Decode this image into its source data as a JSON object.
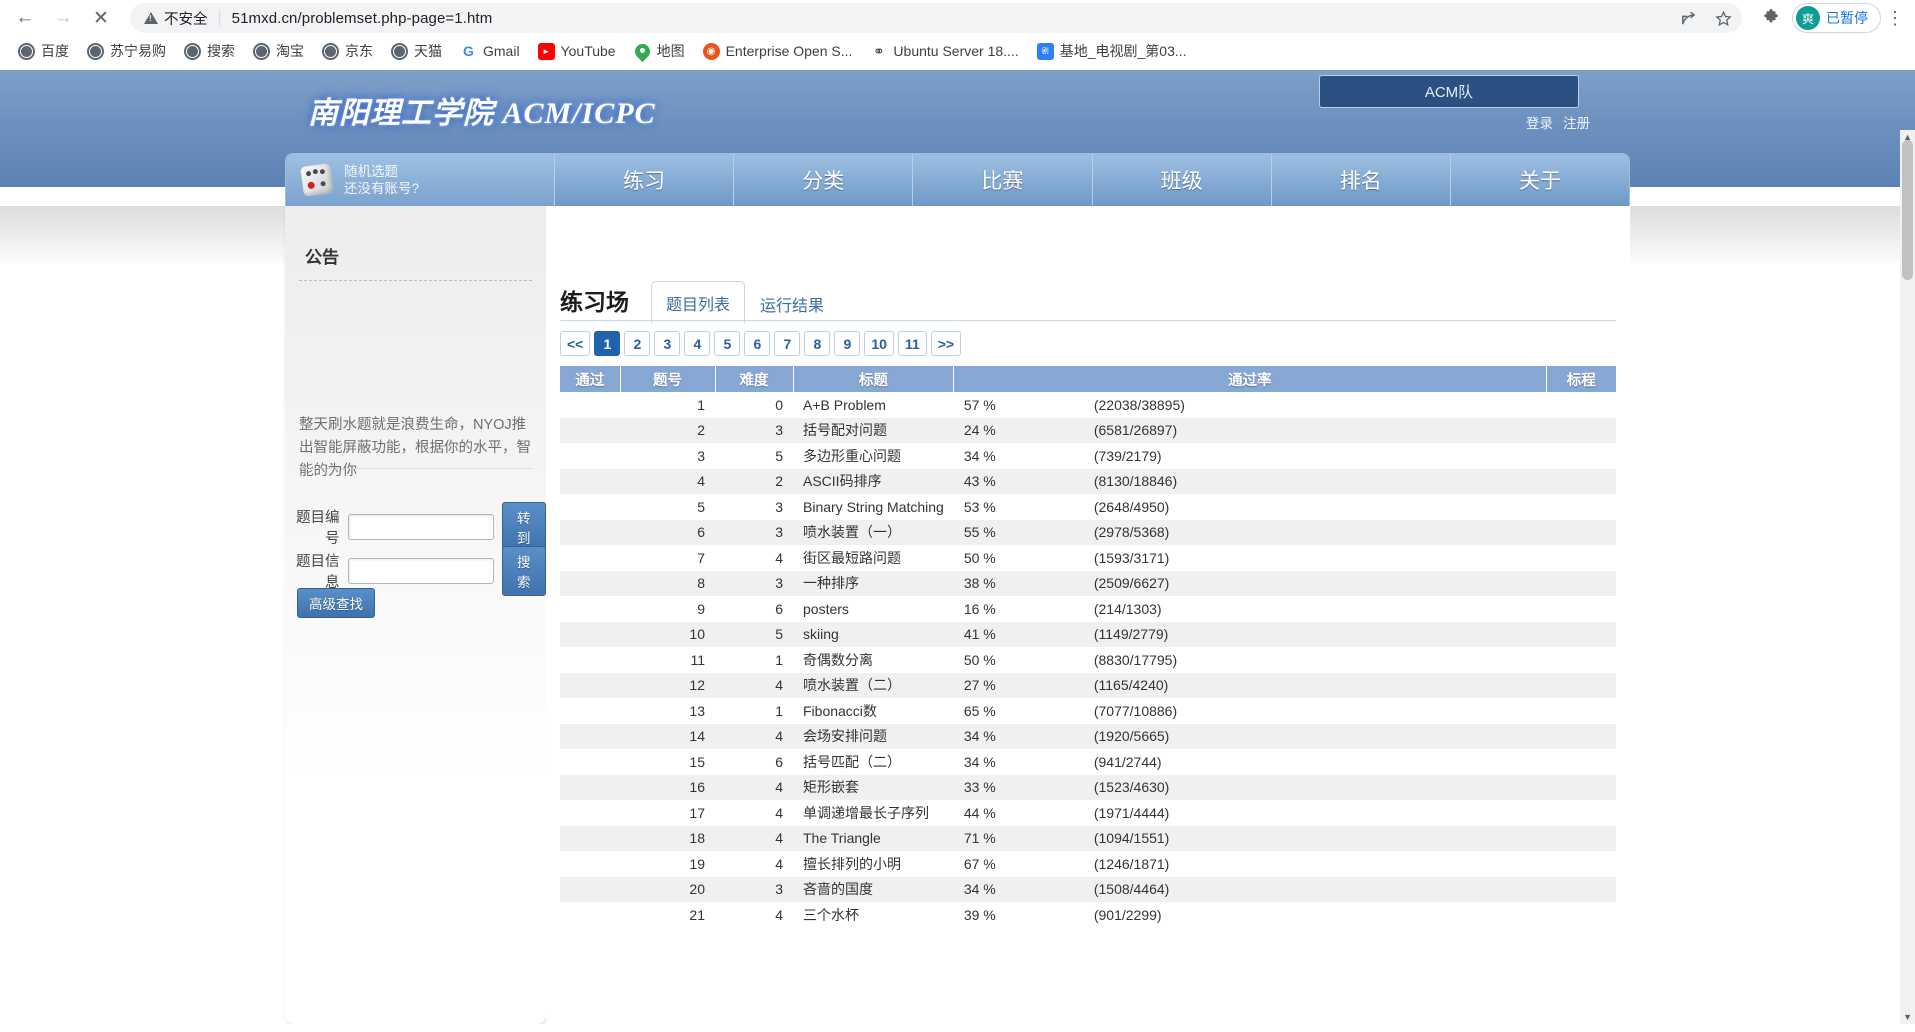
{
  "browser": {
    "back_icon": "back-arrow-icon",
    "forward_icon": "forward-arrow-icon",
    "stop_icon": "stop-icon",
    "stop_glyph": "✕",
    "security_label": "不安全",
    "url": "51mxd.cn/problemset.php-page=1.htm",
    "share_glyph": "↪",
    "star_glyph": "☆",
    "extensions_glyph": "✦",
    "profile_initial": "爽",
    "profile_status": "已暂停",
    "menu_glyph": "⋮",
    "bookmarks": [
      {
        "label": "百度",
        "icon": "globe-icon",
        "kind": "globe"
      },
      {
        "label": "苏宁易购",
        "icon": "globe-icon",
        "kind": "globe"
      },
      {
        "label": "搜索",
        "icon": "globe-icon",
        "kind": "globe"
      },
      {
        "label": "淘宝",
        "icon": "globe-icon",
        "kind": "globe"
      },
      {
        "label": "京东",
        "icon": "globe-icon",
        "kind": "globe"
      },
      {
        "label": "天猫",
        "icon": "globe-icon",
        "kind": "globe"
      },
      {
        "label": "Gmail",
        "icon": "gmail-icon",
        "kind": "g"
      },
      {
        "label": "YouTube",
        "icon": "youtube-icon",
        "kind": "yt"
      },
      {
        "label": "地图",
        "icon": "map-pin-icon",
        "kind": "map"
      },
      {
        "label": "Enterprise Open S...",
        "icon": "ubuntu-icon",
        "kind": "ubuntu"
      },
      {
        "label": "Ubuntu Server 18....",
        "icon": "ubuntu-logo-icon",
        "kind": "ubu2"
      },
      {
        "label": "基地_电视剧_第03...",
        "icon": "video-site-icon",
        "kind": "blue"
      }
    ]
  },
  "site": {
    "logo_text": "南阳理工学院 ACM/ICPC",
    "team_box": "ACM队",
    "login": "登录",
    "register": "注册",
    "nav": {
      "random_title": "随机选题",
      "random_sub": "还没有账号?",
      "items": [
        "练习",
        "分类",
        "比赛",
        "班级",
        "排名",
        "关于"
      ]
    }
  },
  "sidebar": {
    "notice_title": "公告",
    "notice_text": "整天刷水题就是浪费生命，NYOJ推出智能屏蔽功能，根据你的水平，智能的为你",
    "problem_id_label": "题目编号",
    "problem_id_value": "",
    "problem_id_placeholder": "",
    "goto_button": "转到",
    "problem_info_label": "题目信息",
    "problem_info_value": "",
    "problem_info_placeholder": "",
    "search_button": "搜索",
    "advanced_button": "高级查找"
  },
  "main": {
    "page_title": "练习场",
    "tabs": [
      {
        "label": "题目列表",
        "active": true
      },
      {
        "label": "运行结果",
        "active": false
      }
    ],
    "pager": [
      {
        "label": "<<",
        "active": false
      },
      {
        "label": "1",
        "active": true
      },
      {
        "label": "2",
        "active": false
      },
      {
        "label": "3",
        "active": false
      },
      {
        "label": "4",
        "active": false
      },
      {
        "label": "5",
        "active": false
      },
      {
        "label": "6",
        "active": false
      },
      {
        "label": "7",
        "active": false
      },
      {
        "label": "8",
        "active": false
      },
      {
        "label": "9",
        "active": false
      },
      {
        "label": "10",
        "active": false
      },
      {
        "label": "11",
        "active": false
      },
      {
        "label": ">>",
        "active": false
      }
    ],
    "table": {
      "headers": [
        "通过",
        "题号",
        "难度",
        "标题",
        "通过率",
        "标程"
      ],
      "rows": [
        {
          "pass": "",
          "id": "1",
          "difficulty": "0",
          "title": "A+B Problem",
          "rate": "57 %",
          "submissions": "(22038/38895)",
          "std": ""
        },
        {
          "pass": "",
          "id": "2",
          "difficulty": "3",
          "title": "括号配对问题",
          "rate": "24 %",
          "submissions": "(6581/26897)",
          "std": ""
        },
        {
          "pass": "",
          "id": "3",
          "difficulty": "5",
          "title": "多边形重心问题",
          "rate": "34 %",
          "submissions": "(739/2179)",
          "std": ""
        },
        {
          "pass": "",
          "id": "4",
          "difficulty": "2",
          "title": "ASCII码排序",
          "rate": "43 %",
          "submissions": "(8130/18846)",
          "std": ""
        },
        {
          "pass": "",
          "id": "5",
          "difficulty": "3",
          "title": "Binary String Matching",
          "rate": "53 %",
          "submissions": "(2648/4950)",
          "std": ""
        },
        {
          "pass": "",
          "id": "6",
          "difficulty": "3",
          "title": "喷水装置（一）",
          "rate": "55 %",
          "submissions": "(2978/5368)",
          "std": ""
        },
        {
          "pass": "",
          "id": "7",
          "difficulty": "4",
          "title": "街区最短路问题",
          "rate": "50 %",
          "submissions": "(1593/3171)",
          "std": ""
        },
        {
          "pass": "",
          "id": "8",
          "difficulty": "3",
          "title": "一种排序",
          "rate": "38 %",
          "submissions": "(2509/6627)",
          "std": ""
        },
        {
          "pass": "",
          "id": "9",
          "difficulty": "6",
          "title": "posters",
          "rate": "16 %",
          "submissions": "(214/1303)",
          "std": ""
        },
        {
          "pass": "",
          "id": "10",
          "difficulty": "5",
          "title": "skiing",
          "rate": "41 %",
          "submissions": "(1149/2779)",
          "std": ""
        },
        {
          "pass": "",
          "id": "11",
          "difficulty": "1",
          "title": "奇偶数分离",
          "rate": "50 %",
          "submissions": "(8830/17795)",
          "std": ""
        },
        {
          "pass": "",
          "id": "12",
          "difficulty": "4",
          "title": "喷水装置（二）",
          "rate": "27 %",
          "submissions": "(1165/4240)",
          "std": ""
        },
        {
          "pass": "",
          "id": "13",
          "difficulty": "1",
          "title": "Fibonacci数",
          "rate": "65 %",
          "submissions": "(7077/10886)",
          "std": ""
        },
        {
          "pass": "",
          "id": "14",
          "difficulty": "4",
          "title": "会场安排问题",
          "rate": "34 %",
          "submissions": "(1920/5665)",
          "std": ""
        },
        {
          "pass": "",
          "id": "15",
          "difficulty": "6",
          "title": "括号匹配（二）",
          "rate": "34 %",
          "submissions": "(941/2744)",
          "std": ""
        },
        {
          "pass": "",
          "id": "16",
          "difficulty": "4",
          "title": "矩形嵌套",
          "rate": "33 %",
          "submissions": "(1523/4630)",
          "std": ""
        },
        {
          "pass": "",
          "id": "17",
          "difficulty": "4",
          "title": "单调递增最长子序列",
          "rate": "44 %",
          "submissions": "(1971/4444)",
          "std": ""
        },
        {
          "pass": "",
          "id": "18",
          "difficulty": "4",
          "title": "The Triangle",
          "rate": "71 %",
          "submissions": "(1094/1551)",
          "std": ""
        },
        {
          "pass": "",
          "id": "19",
          "difficulty": "4",
          "title": "擅长排列的小明",
          "rate": "67 %",
          "submissions": "(1246/1871)",
          "std": ""
        },
        {
          "pass": "",
          "id": "20",
          "difficulty": "3",
          "title": "吝啬的国度",
          "rate": "34 %",
          "submissions": "(1508/4464)",
          "std": ""
        },
        {
          "pass": "",
          "id": "21",
          "difficulty": "4",
          "title": "三个水杯",
          "rate": "39 %",
          "submissions": "(901/2299)",
          "std": ""
        }
      ]
    }
  },
  "colors": {
    "header_blue": "#6d91bf",
    "nav_blue": "#7ba3cf",
    "table_header": "#87a7d4",
    "link_blue": "#4e7fb5",
    "active_page": "#1f63ae"
  }
}
